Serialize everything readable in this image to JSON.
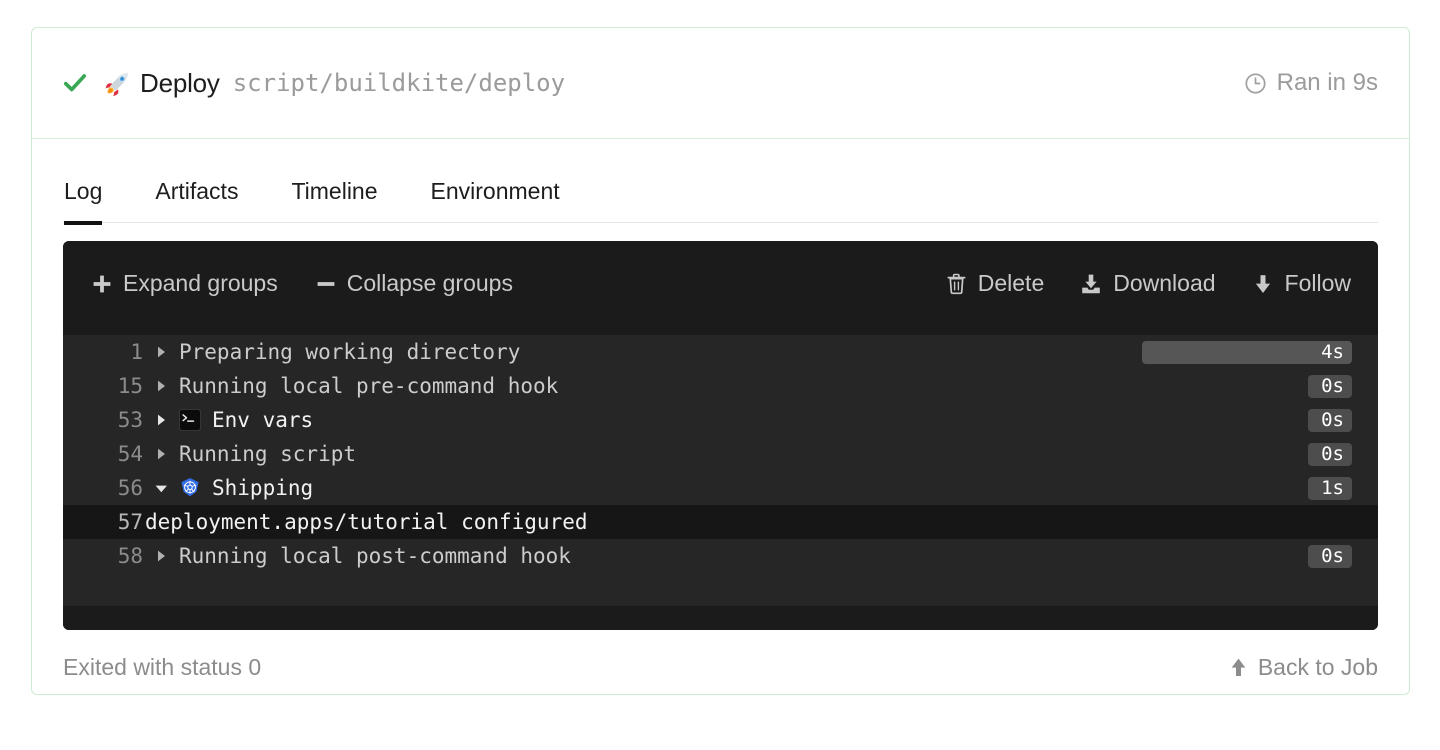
{
  "header": {
    "status_icon": "check-icon",
    "status_color": "#3aa757",
    "emoji": "rocket-emoji",
    "job_name": "Deploy",
    "job_command": "script/buildkite/deploy",
    "duration_icon": "clock-icon",
    "duration_label": "Ran in 9s",
    "border_color": "#cfecd0"
  },
  "tabs": [
    {
      "label": "Log",
      "active": true
    },
    {
      "label": "Artifacts",
      "active": false
    },
    {
      "label": "Timeline",
      "active": false
    },
    {
      "label": "Environment",
      "active": false
    }
  ],
  "log_toolbar": {
    "left": [
      {
        "label": "Expand groups",
        "icon": "plus-icon"
      },
      {
        "label": "Collapse groups",
        "icon": "minus-icon"
      }
    ],
    "right": [
      {
        "label": "Delete",
        "icon": "trash-icon"
      },
      {
        "label": "Download",
        "icon": "download-icon"
      },
      {
        "label": "Follow",
        "icon": "arrow-down-icon"
      }
    ]
  },
  "log_lines": [
    {
      "number": "1",
      "expanded": false,
      "group": true,
      "icon": "none",
      "text": "Preparing working directory",
      "duration": "4s",
      "duration_style": "bar",
      "highlight": false
    },
    {
      "number": "15",
      "expanded": false,
      "group": true,
      "icon": "none",
      "text": "Running local pre-command hook",
      "duration": "0s",
      "duration_style": "pill",
      "highlight": false
    },
    {
      "number": "53",
      "expanded": false,
      "group": true,
      "icon": "terminal",
      "text": "Env vars",
      "duration": "0s",
      "duration_style": "pill",
      "highlight": false
    },
    {
      "number": "54",
      "expanded": false,
      "group": true,
      "icon": "none",
      "text": "Running script",
      "duration": "0s",
      "duration_style": "pill",
      "highlight": false
    },
    {
      "number": "56",
      "expanded": true,
      "group": true,
      "icon": "kubernetes",
      "text": "Shipping",
      "duration": "1s",
      "duration_style": "pill",
      "highlight": false
    },
    {
      "number": "57",
      "expanded": false,
      "group": false,
      "icon": "none",
      "text": "deployment.apps/tutorial configured",
      "duration": "",
      "duration_style": "none",
      "highlight": true
    },
    {
      "number": "58",
      "expanded": false,
      "group": true,
      "icon": "none",
      "text": "Running local post-command hook",
      "duration": "0s",
      "duration_style": "pill",
      "highlight": false
    }
  ],
  "footer": {
    "exit_status": "Exited with status 0",
    "back_label": "Back to Job",
    "back_icon": "arrow-up-icon"
  }
}
